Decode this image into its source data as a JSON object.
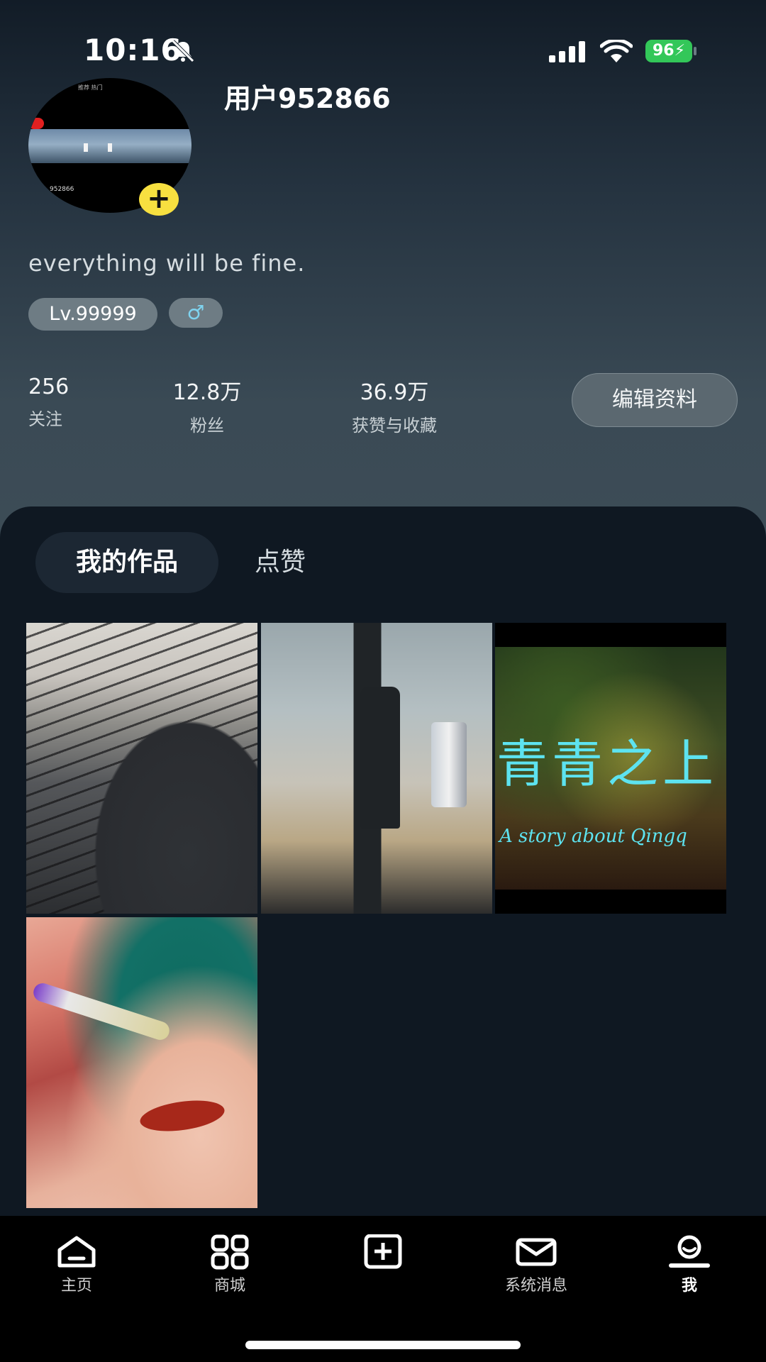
{
  "status_bar": {
    "time": "10:16",
    "battery": "96",
    "icons": [
      "bell-off-icon",
      "signal-icon",
      "wifi-icon",
      "battery-charging-icon"
    ]
  },
  "profile": {
    "username": "用户952866",
    "bio": "everything will be fine.",
    "level": "Lv.99999",
    "gender_symbol": "♂",
    "avatar_add_symbol": "+",
    "avatar_tiny_text": "952866",
    "avatar_tiny_top": "推荐 热门",
    "stats": [
      {
        "value": "256",
        "label": "关注"
      },
      {
        "value": "12.8万",
        "label": "粉丝"
      },
      {
        "value": "36.9万",
        "label": "获赞与收藏"
      }
    ],
    "edit_button": "编辑资料"
  },
  "tabs": [
    {
      "label": "我的作品",
      "active": true
    },
    {
      "label": "点赞",
      "active": false
    }
  ],
  "works": [
    {
      "title": ""
    },
    {
      "title": ""
    },
    {
      "title": "青青之上",
      "subtitle": "A story about Qingq"
    },
    {
      "title": ""
    }
  ],
  "bottom_nav": [
    {
      "label": "主页",
      "icon": "home-icon"
    },
    {
      "label": "商城",
      "icon": "grid-icon"
    },
    {
      "label": "",
      "icon": "add-square-icon"
    },
    {
      "label": "系统消息",
      "icon": "mail-icon"
    },
    {
      "label": "我",
      "icon": "profile-icon",
      "active": true
    }
  ],
  "colors": {
    "accent_yellow": "#f7e040",
    "battery_green": "#33c759",
    "gender_blue": "#7fd3ef",
    "panel_bg": "#0f1822"
  }
}
